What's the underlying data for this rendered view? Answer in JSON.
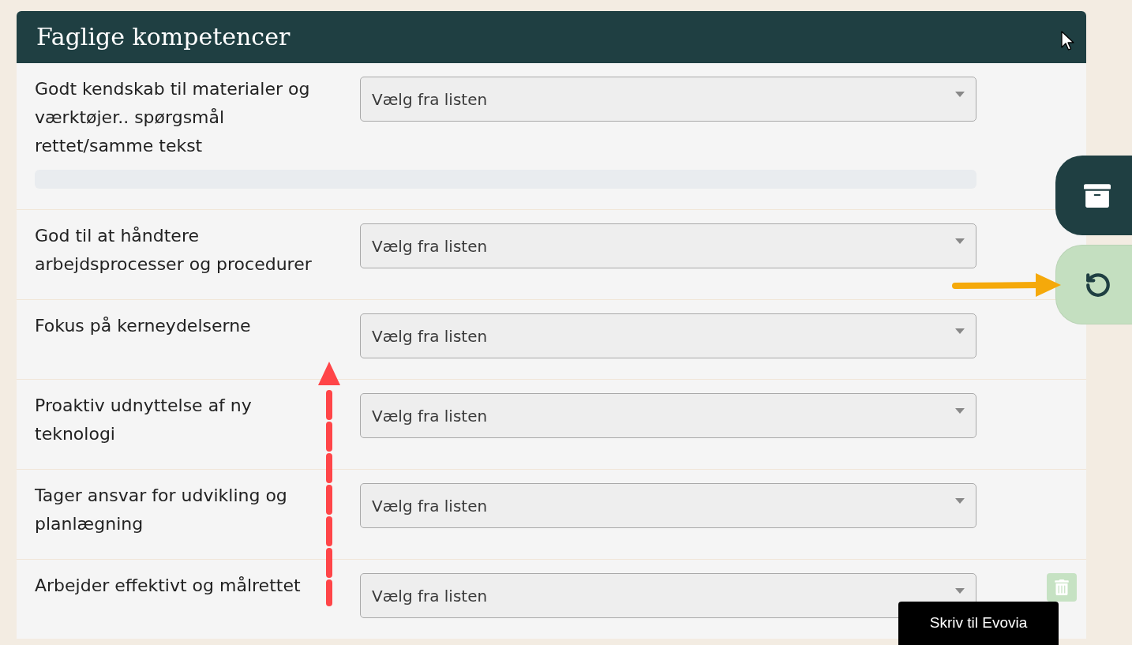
{
  "panel": {
    "title": "Faglige kompetencer"
  },
  "competencies": [
    {
      "label": "Godt kendskab til materialer og værktøjer.. spørgsmål rettet/samme tekst",
      "select": {
        "value": "Vælg fra listen"
      },
      "progress": {
        "level": 0
      },
      "delete_visible": false
    },
    {
      "label": "God til at håndtere arbejdsprocesser og procedurer",
      "select": {
        "value": "Vælg fra listen"
      },
      "delete_visible": false
    },
    {
      "label": "Fokus på kerneydelserne",
      "select": {
        "value": "Vælg fra listen"
      },
      "delete_visible": false
    },
    {
      "label": "Proaktiv udnyttelse af ny teknologi",
      "select": {
        "value": "Vælg fra listen"
      },
      "delete_visible": false
    },
    {
      "label": "Tager ansvar for udvikling og planlægning",
      "select": {
        "value": "Vælg fra listen"
      },
      "delete_visible": false
    },
    {
      "label": "Arbejder effektivt og målrettet",
      "select": {
        "value": "Vælg fra listen"
      },
      "delete_visible": true
    }
  ],
  "side_actions": [
    {
      "kind": "archive"
    },
    {
      "kind": "refresh"
    }
  ],
  "tooltip": {
    "text": "Skriv til Evovia"
  }
}
